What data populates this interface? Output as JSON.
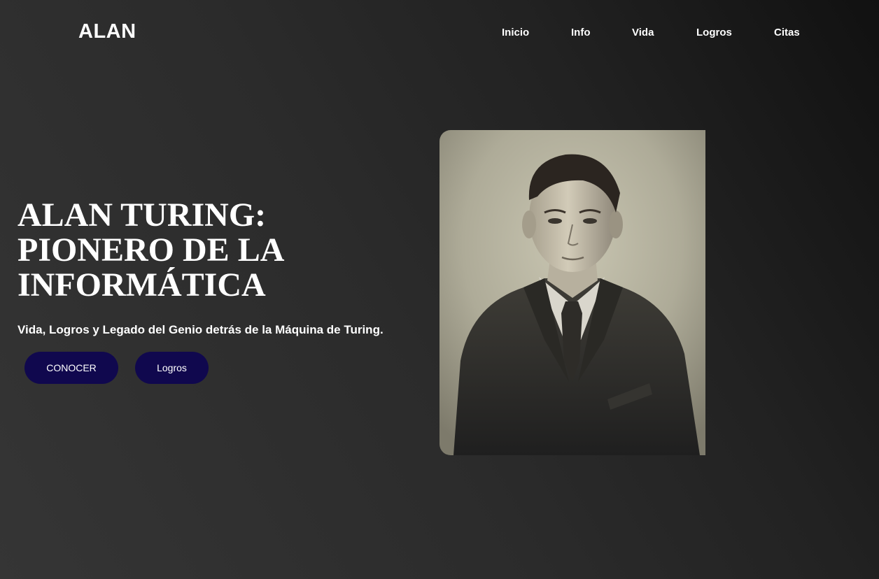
{
  "header": {
    "logo": "ALAN",
    "nav": [
      "Inicio",
      "Info",
      "Vida",
      "Logros",
      "Citas"
    ]
  },
  "hero": {
    "title_lines": [
      "ALAN TURING:",
      "PIONERO DE LA",
      "INFORMÁTICA"
    ],
    "subtitle": "Vida, Logros y Legado del Genio detrás de la Máquina de Turing.",
    "buttons": {
      "primary": "CONOCER",
      "secondary": "Logros"
    }
  },
  "colors": {
    "button_bg": "#10084e",
    "text": "#ffffff"
  }
}
